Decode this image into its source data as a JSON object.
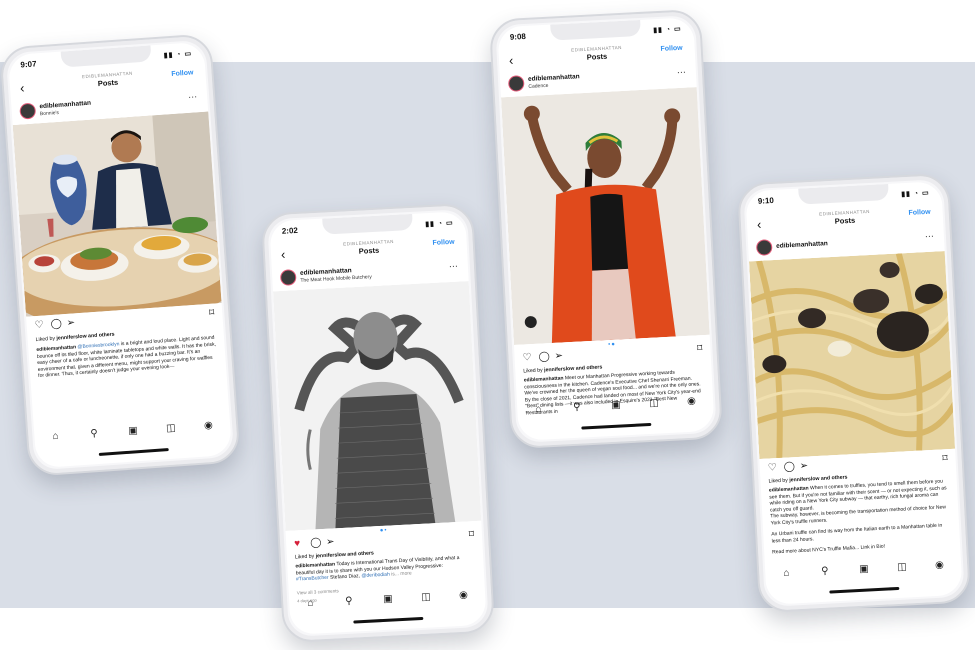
{
  "phones": [
    {
      "time": "9:07",
      "nav_account": "EDIBLEMANHATTAN",
      "nav_title": "Posts",
      "follow": "Follow",
      "username": "ediblemanhattan",
      "location": "Bonnie's",
      "liked_by": "Liked by",
      "liked_user": "jenniferslow",
      "liked_rest": "and others",
      "caption_user": "ediblemanhattan",
      "caption_tag": "@Bonniesbrooklyn",
      "caption": "is a bright and loud place. Light and sound bounce off its tiled floor, white laminate tabletops and white walls. It has the brisk, easy cheer of a cafe or luncheonette, if only one had a buzzing bar. It's an environment that, given a different menu, might support your craving for waffles for dinner. Thus, it certainly doesn't judge your evening look—"
    },
    {
      "time": "2:02",
      "nav_account": "EDIBLEMANHATTAN",
      "nav_title": "Posts",
      "follow": "Follow",
      "username": "ediblemanhattan",
      "location": "The Meat Hook Mobile Butchery",
      "liked_by": "Liked by",
      "liked_user": "jenniferslow",
      "liked_rest": "and others",
      "caption_user": "ediblemanhattan",
      "caption": "Today is International Trans Day of Visibility, and what a beautiful day it is to share with you our Hudson Valley Progressive:",
      "caption_tag": "#TransButcher",
      "caption_tail": "Stefano Diaz,",
      "caption_tag2": "@deribodiah",
      "caption_more": "is... more",
      "view_comments": "View all 3 comments",
      "ago": "4 days ago"
    },
    {
      "time": "9:08",
      "nav_account": "EDIBLEMANHATTAN",
      "nav_title": "Posts",
      "follow": "Follow",
      "username": "ediblemanhattan",
      "location": "Cadence",
      "liked_by": "Liked by",
      "liked_user": "jenniferslow",
      "liked_rest": "and others",
      "caption_user": "ediblemanhattan",
      "caption": "Meet our Manhattan Progressive working towards consciousness in the kitchen. Cadence's Executive Chef Shenarri Freeman. We've crowned her the queen of vegan soul food... and we're not the only ones. By the close of 2021, Cadence had landed on most of New York City's year-end \"Best\" dining lists —it was also included in Esquire's 2021 \"Best New Restaurants in"
    },
    {
      "time": "9:10",
      "nav_account": "EDIBLEMANHATTAN",
      "nav_title": "Posts",
      "follow": "Follow",
      "username": "ediblemanhattan",
      "liked_by": "Liked by",
      "liked_user": "jenniferslow",
      "liked_rest": "and others",
      "caption_user": "ediblemanhattan",
      "caption": "When it comes to truffles, you tend to smell them before you see them. But if you're not familiar with their scent — or not expecting it, such as while riding on a New York City subway — that earthy, rich fungal aroma can catch you off guard.",
      "para2": "The subway, however, is becoming the transportation method of choice for New York City's truffle runners.",
      "para3": "An Urbani truffle can find its way from the Italian earth to a Manhattan table in less than 24 hours.",
      "para4": "Read more about NYC's Truffle Mafia... Link in Bio!"
    }
  ],
  "colors": {
    "background_band": "#d9dee7",
    "follow_blue": "#2f8ff0",
    "liked_heart": "#d6203a"
  },
  "icons": [
    "back-icon",
    "more-icon",
    "heart-icon",
    "comment-icon",
    "share-icon",
    "bookmark-icon",
    "home-icon",
    "search-icon",
    "reels-icon",
    "shop-icon",
    "profile-icon"
  ]
}
